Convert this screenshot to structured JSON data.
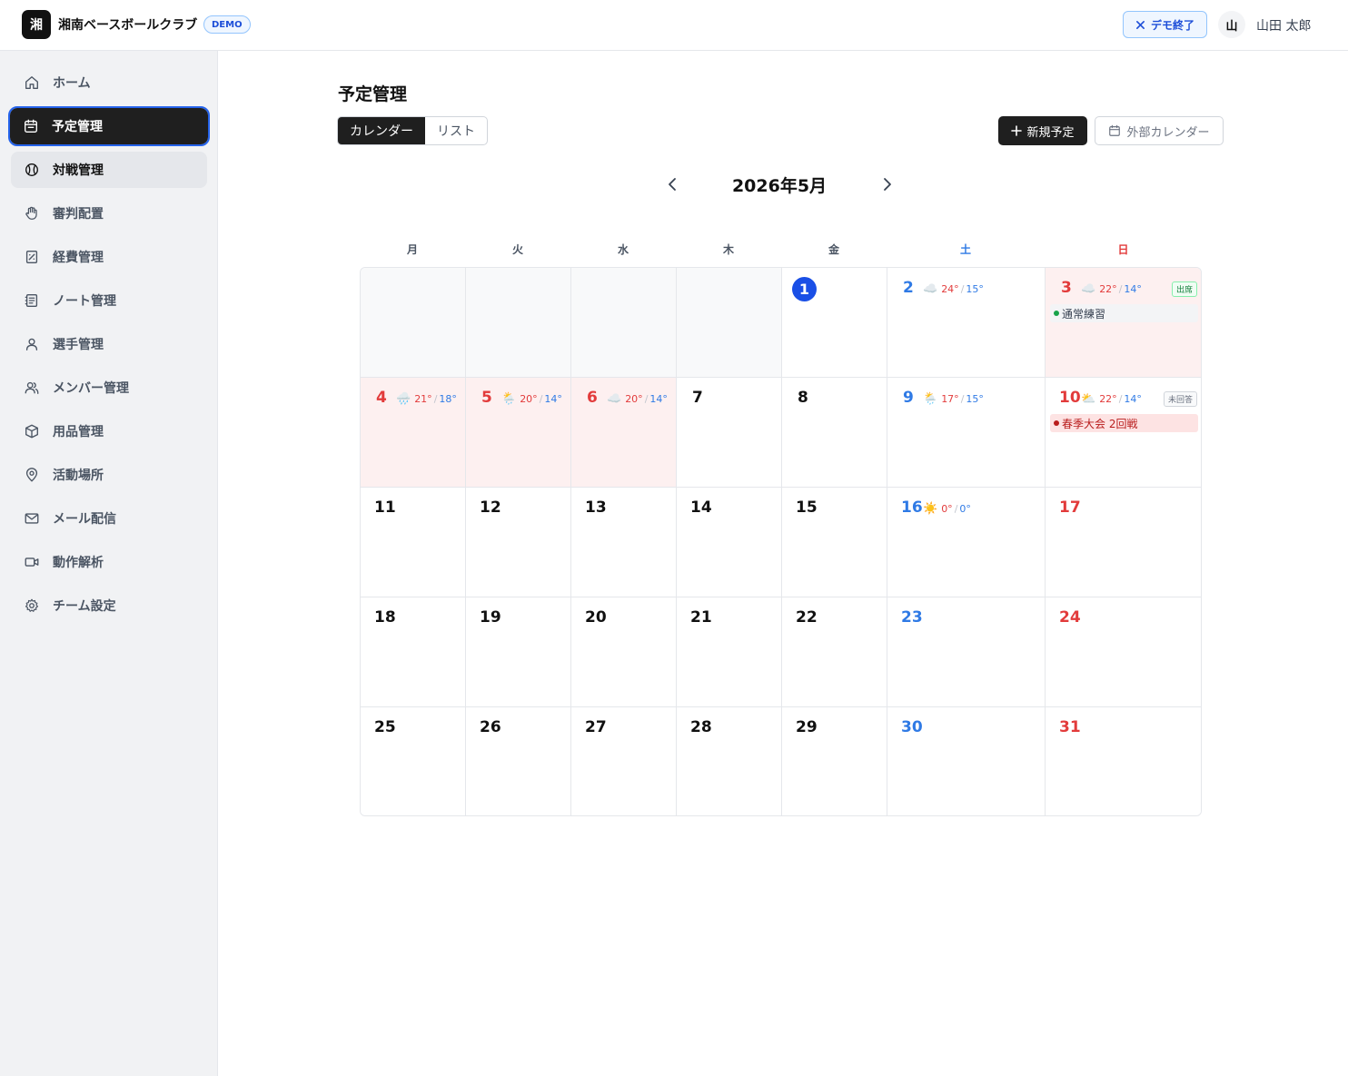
{
  "header": {
    "logo_char": "湘",
    "team_name": "湘南ベースボールクラブ",
    "demo_badge": "DEMO",
    "demo_end_label": "デモ終了",
    "avatar_char": "山",
    "user_name": "山田 太郎"
  },
  "sidebar": {
    "items": [
      {
        "label": "ホーム",
        "icon": "home-icon"
      },
      {
        "label": "予定管理",
        "icon": "calendar-icon",
        "active": true
      },
      {
        "label": "対戦管理",
        "icon": "baseball-icon",
        "hover": true
      },
      {
        "label": "審判配置",
        "icon": "hand-icon"
      },
      {
        "label": "経費管理",
        "icon": "receipt-icon"
      },
      {
        "label": "ノート管理",
        "icon": "notebook-icon"
      },
      {
        "label": "選手管理",
        "icon": "user-icon"
      },
      {
        "label": "メンバー管理",
        "icon": "users-icon"
      },
      {
        "label": "用品管理",
        "icon": "box-icon"
      },
      {
        "label": "活動場所",
        "icon": "map-pin-icon"
      },
      {
        "label": "メール配信",
        "icon": "mail-icon"
      },
      {
        "label": "動作解析",
        "icon": "video-icon"
      },
      {
        "label": "チーム設定",
        "icon": "gear-icon"
      }
    ]
  },
  "main": {
    "title": "予定管理",
    "view_tabs": [
      "カレンダー",
      "リスト"
    ],
    "active_view": "カレンダー",
    "new_event_label": "新規予定",
    "external_calendar_label": "外部カレンダー",
    "month_label": "2026年5月",
    "weekdays": [
      "月",
      "火",
      "水",
      "木",
      "金",
      "土",
      "日"
    ]
  },
  "colors": {
    "accent_blue": "#1a4fe6",
    "saturday": "#2f7ae5",
    "sunday": "#e23b3b",
    "holiday_bg": "#fdf0f0",
    "game_event": "#b91c1c",
    "practice_dot": "#16a34a"
  },
  "calendar": {
    "weeks": [
      [
        {
          "empty": true
        },
        {
          "empty": true
        },
        {
          "empty": true
        },
        {
          "empty": true
        },
        {
          "day": "1",
          "today": true
        },
        {
          "day": "2",
          "kind": "sat",
          "weather": {
            "icon": "☁️",
            "hi": "24°",
            "lo": "15°"
          }
        },
        {
          "day": "3",
          "kind": "sun",
          "holiday": true,
          "weather": {
            "icon": "☁️",
            "hi": "22°",
            "lo": "14°"
          },
          "status": "出席",
          "status_type": "green",
          "event": {
            "title": "通常練習",
            "type": "practice"
          }
        }
      ],
      [
        {
          "day": "4",
          "kind": "sun",
          "holiday": true,
          "weather": {
            "icon": "🌧️",
            "hi": "21°",
            "lo": "18°"
          }
        },
        {
          "day": "5",
          "kind": "sun",
          "holiday": true,
          "weather": {
            "icon": "🌦️",
            "hi": "20°",
            "lo": "14°"
          }
        },
        {
          "day": "6",
          "kind": "sun",
          "holiday": true,
          "weather": {
            "icon": "☁️",
            "hi": "20°",
            "lo": "14°"
          }
        },
        {
          "day": "7"
        },
        {
          "day": "8"
        },
        {
          "day": "9",
          "kind": "sat",
          "weather": {
            "icon": "🌦️",
            "hi": "17°",
            "lo": "15°"
          }
        },
        {
          "day": "10",
          "kind": "sun",
          "weather": {
            "icon": "⛅",
            "hi": "22°",
            "lo": "14°"
          },
          "status": "未回答",
          "status_type": "gray",
          "event": {
            "title": "春季大会 2回戦",
            "type": "game"
          }
        }
      ],
      [
        {
          "day": "11"
        },
        {
          "day": "12"
        },
        {
          "day": "13"
        },
        {
          "day": "14"
        },
        {
          "day": "15"
        },
        {
          "day": "16",
          "kind": "sat",
          "weather": {
            "icon": "☀️",
            "hi": "0°",
            "lo": "0°"
          }
        },
        {
          "day": "17",
          "kind": "sun"
        }
      ],
      [
        {
          "day": "18"
        },
        {
          "day": "19"
        },
        {
          "day": "20"
        },
        {
          "day": "21"
        },
        {
          "day": "22"
        },
        {
          "day": "23",
          "kind": "sat"
        },
        {
          "day": "24",
          "kind": "sun"
        }
      ],
      [
        {
          "day": "25"
        },
        {
          "day": "26"
        },
        {
          "day": "27"
        },
        {
          "day": "28"
        },
        {
          "day": "29"
        },
        {
          "day": "30",
          "kind": "sat"
        },
        {
          "day": "31",
          "kind": "sun"
        }
      ]
    ]
  }
}
